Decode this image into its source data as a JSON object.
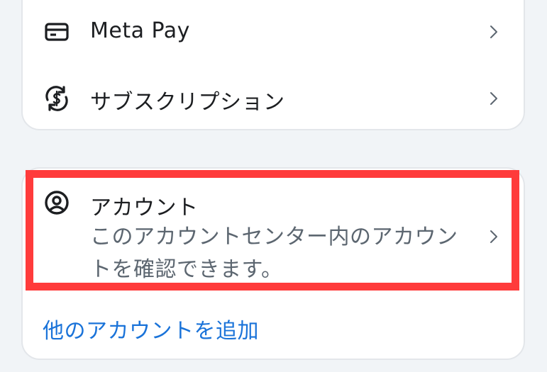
{
  "menu": {
    "meta_pay": {
      "label": "Meta Pay",
      "icon": "card-icon"
    },
    "subscriptions": {
      "label": "サブスクリプション",
      "icon": "subscription-dollar-icon"
    }
  },
  "account": {
    "title": "アカウント",
    "description": "このアカウントセンター内のアカウントを確認できます。",
    "icon": "user-circle-icon"
  },
  "add_account": {
    "label": "他のアカウントを追加"
  },
  "colors": {
    "highlight": "#ff3b3b",
    "link": "#1a73d9"
  }
}
